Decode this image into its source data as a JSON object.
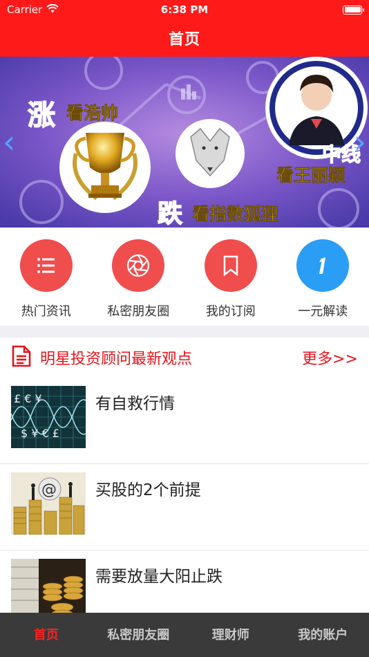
{
  "status_bar": {
    "carrier": "Carrier",
    "time": "6:38 PM"
  },
  "nav": {
    "title": "首页"
  },
  "banner": {
    "text1_big": "涨",
    "text1_rest": "看浩帅",
    "text2_big": "跌",
    "text2_rest": "看指数狐狸",
    "text3_big": "中线",
    "text3_rest": "看王丽颖"
  },
  "quick_nav": [
    {
      "label": "热门资讯",
      "icon": "list-icon",
      "color": "#f04d4d"
    },
    {
      "label": "私密朋友圈",
      "icon": "aperture-icon",
      "color": "#f04d4d"
    },
    {
      "label": "我的订阅",
      "icon": "bookmark-icon",
      "color": "#f04d4d"
    },
    {
      "label": "一元解读",
      "icon": "number-one-icon",
      "color": "#2a9df4"
    }
  ],
  "section": {
    "title": "明星投资顾问最新观点",
    "more": "更多>>"
  },
  "articles": [
    {
      "title": "有自救行情"
    },
    {
      "title": "买股的2个前提"
    },
    {
      "title": "需要放量大阳止跌"
    }
  ],
  "tabbar": [
    {
      "label": "首页",
      "active": true
    },
    {
      "label": "私密朋友圈",
      "active": false
    },
    {
      "label": "理财师",
      "active": false
    },
    {
      "label": "我的账户",
      "active": false
    }
  ],
  "colors": {
    "brand_red": "#ff1a1a",
    "accent_red": "#e8121a",
    "accent_blue": "#2a9df4",
    "tabbar_bg": "#3a3a3a"
  }
}
